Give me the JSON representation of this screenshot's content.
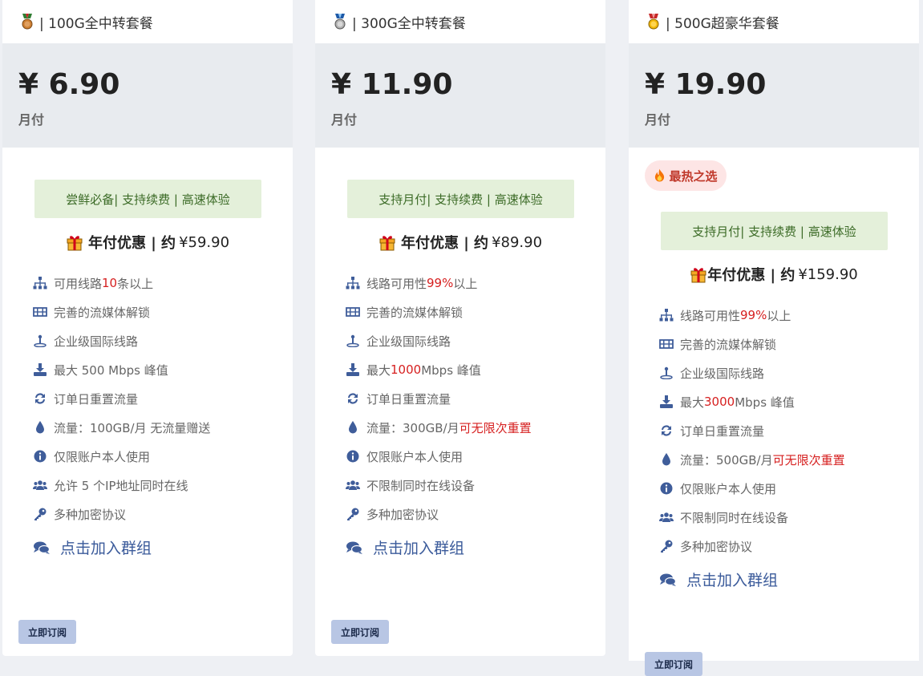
{
  "plans": [
    {
      "medal_icon": "bronze-medal-icon",
      "title": "| 100G全中转套餐",
      "price": "¥ 6.90",
      "period": "月付",
      "note": "尝鲜必备| 支持续费 | 高速体验",
      "annual_label": "年付优惠 | 约",
      "annual_price": "¥59.90",
      "features": [
        {
          "icon": "network-icon",
          "parts": [
            "可用线路",
            "10",
            "条以上"
          ]
        },
        {
          "icon": "film-icon",
          "parts": [
            "完善的流媒体解锁"
          ]
        },
        {
          "icon": "location-icon",
          "parts": [
            "企业级国际线路"
          ]
        },
        {
          "icon": "download-icon",
          "parts": [
            "最大 500 Mbps 峰值"
          ]
        },
        {
          "icon": "refresh-icon",
          "parts": [
            "订单日重置流量"
          ]
        },
        {
          "icon": "drop-icon",
          "parts": [
            "流量：100GB/月 无流量赠送"
          ]
        },
        {
          "icon": "info-icon",
          "parts": [
            "仅限账户本人使用"
          ]
        },
        {
          "icon": "users-icon",
          "parts": [
            "允许 5 个IP地址同时在线"
          ]
        },
        {
          "icon": "key-icon",
          "parts": [
            "多种加密协议"
          ]
        }
      ],
      "group_link": "点击加入群组",
      "subscribe": "立即订阅"
    },
    {
      "medal_icon": "silver-medal-icon",
      "title": "| 300G全中转套餐",
      "price": "¥ 11.90",
      "period": "月付",
      "note": "支持月付| 支持续费 | 高速体验",
      "annual_label": "年付优惠 | 约",
      "annual_price": "¥89.90",
      "features": [
        {
          "icon": "network-icon",
          "parts": [
            "线路可用性",
            "99%",
            "以上"
          ]
        },
        {
          "icon": "film-icon",
          "parts": [
            "完善的流媒体解锁"
          ]
        },
        {
          "icon": "location-icon",
          "parts": [
            "企业级国际线路"
          ]
        },
        {
          "icon": "download-icon",
          "parts": [
            "最大 ",
            "1000",
            "Mbps 峰值"
          ]
        },
        {
          "icon": "refresh-icon",
          "parts": [
            "订单日重置流量"
          ]
        },
        {
          "icon": "drop-icon",
          "parts": [
            "流量：300GB/月 ",
            "可无限次重置",
            ""
          ]
        },
        {
          "icon": "info-icon",
          "parts": [
            "仅限账户本人使用"
          ]
        },
        {
          "icon": "users-icon",
          "parts": [
            "不限制同时在线设备"
          ]
        },
        {
          "icon": "key-icon",
          "parts": [
            "多种加密协议"
          ]
        }
      ],
      "group_link": "点击加入群组",
      "subscribe": "立即订阅"
    },
    {
      "medal_icon": "gold-medal-icon",
      "title": "| 500G超豪华套餐",
      "price": "¥ 19.90",
      "period": "月付",
      "hot_badge": "最热之选",
      "note": "支持月付| 支持续费 | 高速体验",
      "annual_label": "年付优惠 | 约",
      "annual_price": "¥159.90",
      "features": [
        {
          "icon": "network-icon",
          "parts": [
            "线路可用性",
            "99%",
            "以上"
          ]
        },
        {
          "icon": "film-icon",
          "parts": [
            "完善的流媒体解锁"
          ]
        },
        {
          "icon": "location-icon",
          "parts": [
            "企业级国际线路"
          ]
        },
        {
          "icon": "download-icon",
          "parts": [
            "最大 ",
            "3000",
            "Mbps 峰值"
          ]
        },
        {
          "icon": "refresh-icon",
          "parts": [
            "订单日重置流量"
          ]
        },
        {
          "icon": "drop-icon",
          "parts": [
            "流量：500GB/月 ",
            "可无限次重置",
            ""
          ]
        },
        {
          "icon": "info-icon",
          "parts": [
            "仅限账户本人使用"
          ]
        },
        {
          "icon": "users-icon",
          "parts": [
            "不限制同时在线设备"
          ]
        },
        {
          "icon": "key-icon",
          "parts": [
            "多种加密协议"
          ]
        }
      ],
      "group_link": "点击加入群组",
      "subscribe": "立即订阅"
    }
  ],
  "colors": {
    "accent_red": "#d62020",
    "icon_blue": "#3f5d9a",
    "note_bg": "#e4f0da",
    "button_bg": "#b8c6e4"
  }
}
